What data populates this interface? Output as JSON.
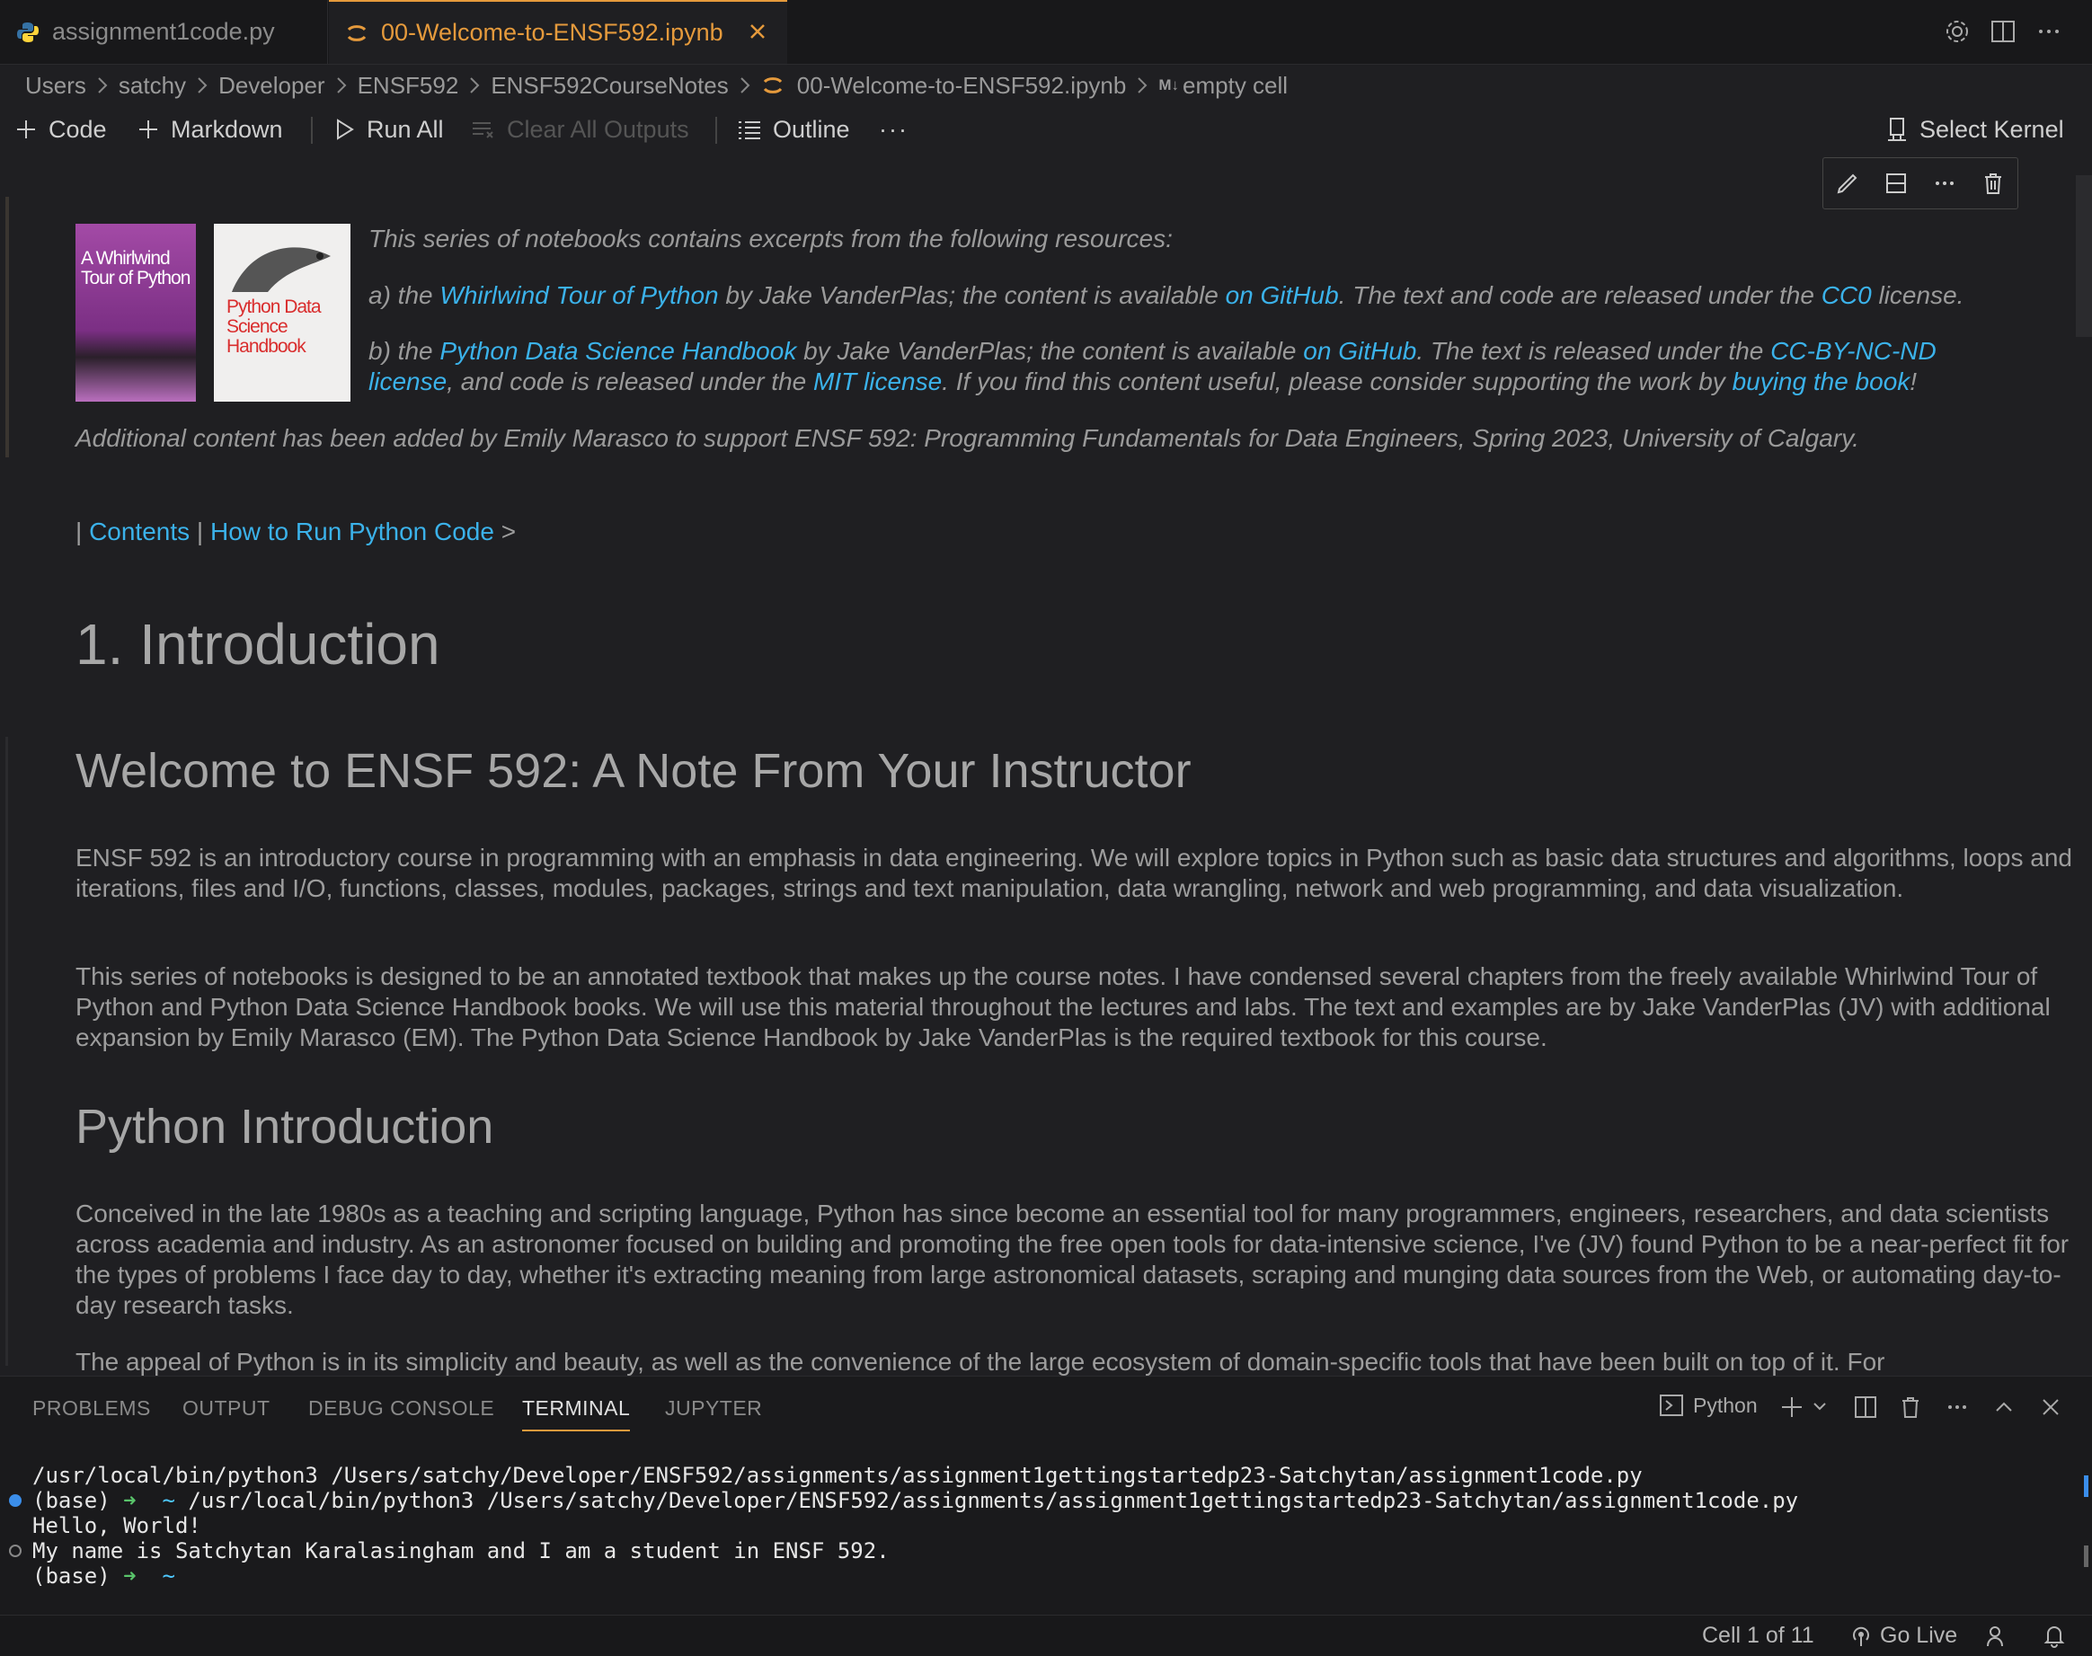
{
  "tabs": [
    {
      "label": "assignment1code.py",
      "icon": "python-icon"
    },
    {
      "label": "00-Welcome-to-ENSF592.ipynb",
      "icon": "jupyter-icon",
      "active": true
    }
  ],
  "breadcrumb": [
    "Users",
    "satchy",
    "Developer",
    "ENSF592",
    "ENSF592CourseNotes",
    "00-Welcome-to-ENSF592.ipynb",
    "empty cell"
  ],
  "breadcrumb_md_marker": "M↓",
  "toolbar": {
    "code": "Code",
    "markdown": "Markdown",
    "run_all": "Run All",
    "clear_outputs": "Clear All Outputs",
    "outline": "Outline",
    "more": "···",
    "select_kernel": "Select Kernel"
  },
  "books": {
    "book1_title": "A Whirlwind Tour of Python",
    "book2_title": "Python Data Science Handbook"
  },
  "cell1": {
    "intro": "This series of notebooks contains excerpts from the following resources:",
    "a_prefix": "a) the ",
    "a_link1": "Whirlwind Tour of Python",
    "a_mid": " by Jake VanderPlas; the content is available ",
    "a_link2": "on GitHub",
    "a_mid2": ". The text and code are released under the ",
    "a_link3": "CC0",
    "a_end": " license.",
    "b_prefix": "b) the ",
    "b_link1": "Python Data Science Handbook",
    "b_mid": " by Jake VanderPlas; the content is available ",
    "b_link2": "on GitHub",
    "b_mid2": ". The text is released under the ",
    "b_link3a": "CC-BY-NC-ND",
    "b_link3b": "license",
    "b_mid3": ", and code is released under the ",
    "b_link4": "MIT license",
    "b_mid4": ". If you find this content useful, please consider supporting the work by ",
    "b_link5": "buying the book",
    "b_end": "!",
    "additional": "Additional content has been added by Emily Marasco to support ENSF 592: Programming Fundamentals for Data Engineers, Spring 2023, University of Calgary."
  },
  "nav": {
    "bar1": "| ",
    "contents": "Contents",
    "bar2": " | ",
    "next": "How to Run Python Code",
    "arrow": " >"
  },
  "headings": {
    "h1": "1. Introduction",
    "h2_welcome": "Welcome to ENSF 592: A Note From Your Instructor",
    "h2_python": "Python Introduction"
  },
  "paragraphs": {
    "p1": "ENSF 592 is an introductory course in programming with an emphasis in data engineering. We will explore topics in Python such as basic data structures and algorithms, loops and iterations, files and I/O, functions, classes, modules, packages, strings and text manipulation, data wrangling, network and web programming, and data visualization.",
    "p2": "This series of notebooks is designed to be an annotated textbook that makes up the course notes. I have condensed several chapters from the freely available Whirlwind Tour of Python and Python Data Science Handbook books. We will use this material throughout the lectures and labs. The text and examples are by Jake VanderPlas (JV) with additional expansion by Emily Marasco (EM). The Python Data Science Handbook by Jake VanderPlas is the required textbook for this course.",
    "p3": "Conceived in the late 1980s as a teaching and scripting language, Python has since become an essential tool for many programmers, engineers, researchers, and data scientists across academia and industry. As an astronomer focused on building and promoting the free open tools for data-intensive science, I've (JV) found Python to be a near-perfect fit for the types of problems I face day to day, whether it's extracting meaning from large astronomical datasets, scraping and munging data sources from the Web, or automating day-to-day research tasks.",
    "p4": "The appeal of Python is in its simplicity and beauty, as well as the convenience of the large ecosystem of domain-specific tools that have been built on top of it. For"
  },
  "panel": {
    "tabs": [
      "PROBLEMS",
      "OUTPUT",
      "DEBUG CONSOLE",
      "TERMINAL",
      "JUPYTER"
    ],
    "active_tab": "TERMINAL",
    "shell_label": "Python"
  },
  "terminal": {
    "line1": "/usr/local/bin/python3 /Users/satchy/Developer/ENSF592/assignments/assignment1gettingstartedp23-Satchytan/assignment1code.py",
    "line2_prompt": "(base) ",
    "line2_arrow": "➜",
    "line2_tilde": "  ~",
    "line2_cmd": " /usr/local/bin/python3 /Users/satchy/Developer/ENSF592/assignments/assignment1gettingstartedp23-Satchytan/assignment1code.py",
    "line3": "Hello, World!",
    "line4": "My name is Satchytan Karalasingham and I am a student in ENSF 592.",
    "line5_prompt": "(base) ",
    "line5_arrow": "➜",
    "line5_tilde": "  ~"
  },
  "status": {
    "cell": "Cell 1 of 11",
    "golive": "Go Live"
  },
  "colors": {
    "accent": "#e59a3c",
    "link": "#3bb2ea",
    "background": "#1f1f22"
  }
}
